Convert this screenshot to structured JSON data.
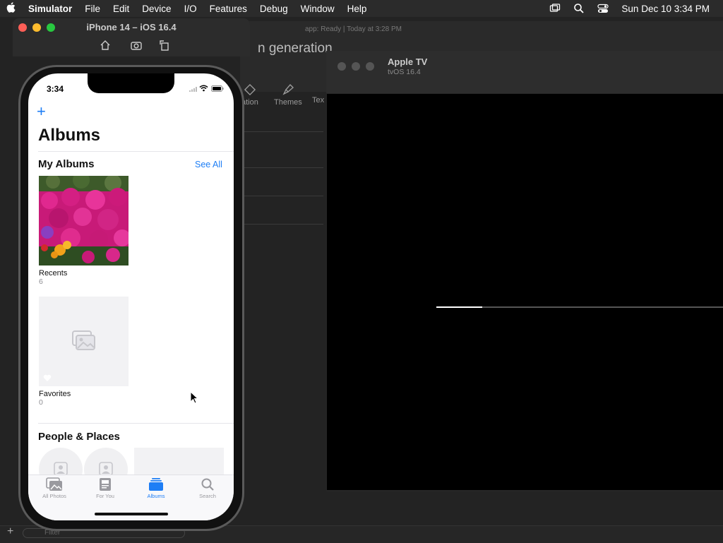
{
  "menubar": {
    "apple_icon": "apple-logo-icon",
    "app_name": "Simulator",
    "items": [
      "File",
      "Edit",
      "Device",
      "I/O",
      "Features",
      "Debug",
      "Window",
      "Help"
    ],
    "datetime": "Sun Dec 10  3:34 PM",
    "right_icons": [
      "screen-mirroring-icon",
      "spotlight-search-icon",
      "control-center-icon"
    ]
  },
  "xcode": {
    "title": "n generation",
    "status": "app: Ready | Today at 3:28 PM",
    "tools": [
      "ation",
      "Themes",
      "Tex"
    ],
    "filter_placeholder": "Filter"
  },
  "simulator_phone": {
    "title": "iPhone 14 – iOS 16.4",
    "toolbar_icons": [
      "home-icon",
      "screenshot-icon",
      "rotate-icon"
    ]
  },
  "phone": {
    "status_time": "3:34",
    "add_button": "+",
    "title": "Albums",
    "my_albums": {
      "heading": "My Albums",
      "see_all": "See All",
      "albums": [
        {
          "name": "Recents",
          "count": "6"
        },
        {
          "name": "Favorites",
          "count": "0"
        }
      ]
    },
    "people_places": {
      "heading": "People & Places"
    },
    "tabs": [
      {
        "label": "All Photos",
        "icon": "photos-icon",
        "active": false
      },
      {
        "label": "For You",
        "icon": "for-you-icon",
        "active": false
      },
      {
        "label": "Albums",
        "icon": "albums-icon",
        "active": true
      },
      {
        "label": "Search",
        "icon": "search-icon",
        "active": false
      }
    ]
  },
  "apple_tv": {
    "title": "Apple TV",
    "subtitle": "tvOS 16.4",
    "loading_progress": 0.16
  },
  "colors": {
    "accent": "#1e7ef5",
    "menubar": "#2b2b2b",
    "tv_screen": "#000000"
  }
}
